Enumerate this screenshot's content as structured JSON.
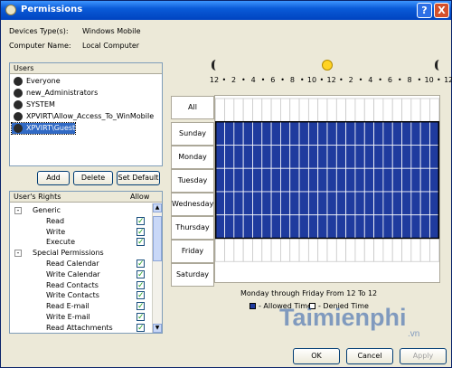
{
  "window": {
    "title": "Permissions",
    "help_glyph": "?",
    "close_glyph": "X"
  },
  "info": {
    "devices_label": "Devices Type(s):",
    "devices_value": "Windows Mobile",
    "computer_label": "Computer Name:",
    "computer_value": "Local Computer"
  },
  "users": {
    "header": "Users",
    "items": [
      {
        "label": "Everyone",
        "selected": false
      },
      {
        "label": "new_Administrators",
        "selected": false
      },
      {
        "label": "SYSTEM",
        "selected": false
      },
      {
        "label": "XPVIRT\\Allow_Access_To_WinMobile",
        "selected": false
      },
      {
        "label": "XPVIRT\\Guest",
        "selected": true
      }
    ]
  },
  "buttons": {
    "add": "Add",
    "delete": "Delete",
    "set_default": "Set Default",
    "ok": "OK",
    "cancel": "Cancel",
    "apply": "Apply"
  },
  "rights": {
    "header": "User's Rights",
    "allow_header": "Allow",
    "rows": [
      {
        "label": "Generic",
        "type": "group",
        "toggle": "-"
      },
      {
        "label": "Read",
        "type": "item",
        "checked": true
      },
      {
        "label": "Write",
        "type": "item",
        "checked": true
      },
      {
        "label": "Execute",
        "type": "item",
        "checked": true
      },
      {
        "label": "Special Permissions",
        "type": "group",
        "toggle": "-"
      },
      {
        "label": "Read Calendar",
        "type": "item",
        "checked": true
      },
      {
        "label": "Write Calendar",
        "type": "item",
        "checked": true
      },
      {
        "label": "Read Contacts",
        "type": "item",
        "checked": true
      },
      {
        "label": "Write Contacts",
        "type": "item",
        "checked": true
      },
      {
        "label": "Read E-mail",
        "type": "item",
        "checked": true
      },
      {
        "label": "Write E-mail",
        "type": "item",
        "checked": true
      },
      {
        "label": "Read Attachments",
        "type": "item",
        "checked": true
      }
    ],
    "check_glyph": "✓"
  },
  "schedule": {
    "all_label": "All",
    "days": [
      "Sunday",
      "Monday",
      "Tuesday",
      "Wednesday",
      "Thursday",
      "Friday",
      "Saturday"
    ],
    "hour_labels": [
      "12",
      "2",
      "4",
      "6",
      "8",
      "10",
      "12",
      "2",
      "4",
      "6",
      "8",
      "10",
      "12"
    ],
    "allowed_days": [
      1,
      2,
      3,
      4,
      5
    ],
    "hours_per_day": 24,
    "allowed_color": "#1f3b9e",
    "summary": "Monday through Friday From 12 To 12",
    "legend_allowed": "- Allowed Time",
    "legend_denied": "- Denied Time"
  },
  "watermark": {
    "text": "Taimienphi",
    "sub": ".vn"
  }
}
